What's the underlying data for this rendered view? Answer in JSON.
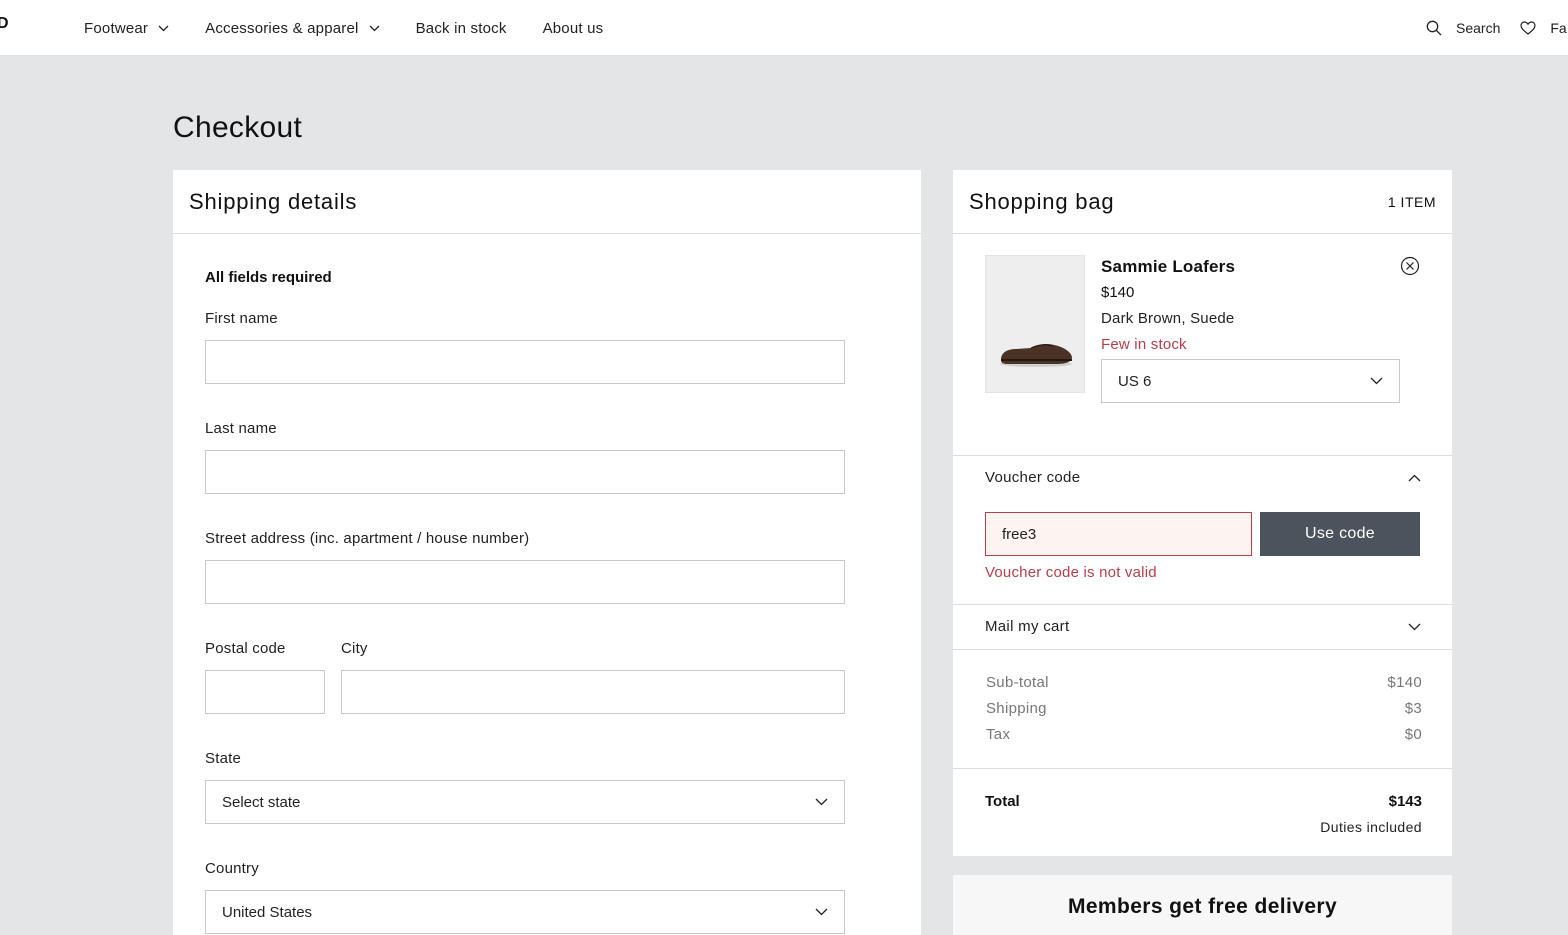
{
  "nav": {
    "logo": "ND",
    "items": [
      {
        "label": "Footwear",
        "has_dropdown": true
      },
      {
        "label": "Accessories & apparel",
        "has_dropdown": true
      },
      {
        "label": "Back in stock",
        "has_dropdown": false
      },
      {
        "label": "About us",
        "has_dropdown": false
      }
    ],
    "search_label": "Search",
    "favorites_label": "Fa"
  },
  "page": {
    "title": "Checkout"
  },
  "shipping": {
    "heading": "Shipping details",
    "required_note": "All fields required",
    "first_name_label": "First name",
    "first_name_value": "",
    "last_name_label": "Last name",
    "last_name_value": "",
    "street_label": "Street address (inc. apartment / house number)",
    "street_value": "",
    "postal_label": "Postal code",
    "postal_value": "",
    "city_label": "City",
    "city_value": "",
    "state_label": "State",
    "state_value": "Select state",
    "country_label": "Country",
    "country_value": "United States"
  },
  "bag": {
    "heading": "Shopping bag",
    "count": "1 ITEM",
    "item": {
      "name": "Sammie Loafers",
      "price": "$140",
      "variant": "Dark Brown, Suede",
      "stock": "Few in stock",
      "size": "US 6"
    },
    "voucher": {
      "heading": "Voucher code",
      "value": "free3",
      "button": "Use code",
      "error": "Voucher code is not valid"
    },
    "mail_cart": "Mail my cart",
    "summary": [
      {
        "label": "Sub-total",
        "value": "$140"
      },
      {
        "label": "Shipping",
        "value": "$3"
      },
      {
        "label": "Tax",
        "value": "$0"
      }
    ],
    "total_label": "Total",
    "total_value": "$143",
    "duties": "Duties included"
  },
  "members": {
    "text": "Members get free delivery"
  },
  "colors": {
    "background": "#e3e5e7",
    "error": "#b3404a",
    "button": "#4b535d"
  }
}
